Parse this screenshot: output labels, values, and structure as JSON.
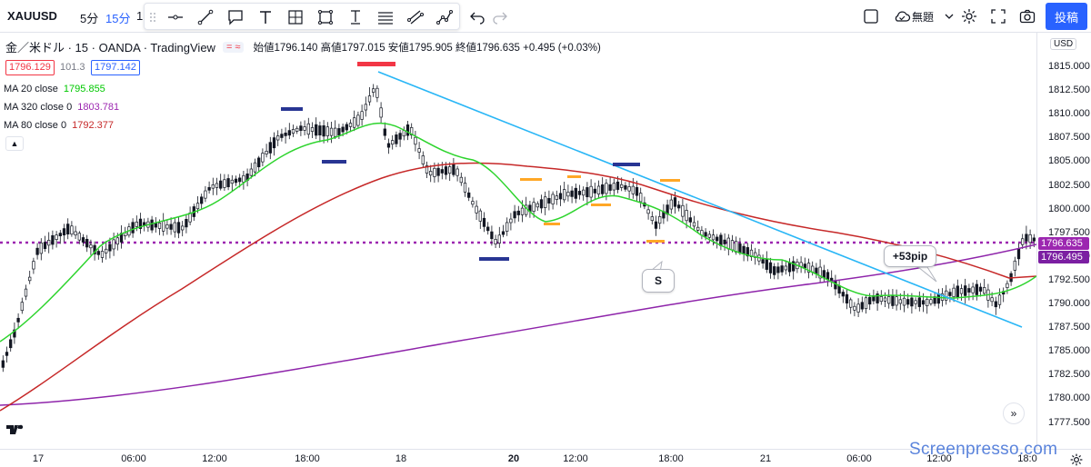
{
  "header": {
    "symbol": "XAUUSD",
    "timeframes": [
      "5分",
      "15分",
      "1"
    ],
    "active_timeframe_index": 1,
    "layout_name": "無題",
    "publish_label": "投稿"
  },
  "legend": {
    "instrument": "金／米ドル · 15 · OANDA · TradingView",
    "ohlc": "始値1796.140 高値1797.015 安値1795.905 終値1796.635 +0.495 (+0.03%)",
    "toggle": "= ≈",
    "bid": "1796.129",
    "spread": "101.3",
    "ask": "1797.142",
    "indicators": [
      {
        "label": "MA 20 close",
        "value": "1795.855",
        "color": "#00c800"
      },
      {
        "label": "MA 320 close 0",
        "value": "1803.781",
        "color": "#9c27b0"
      },
      {
        "label": "MA 80 close 0",
        "value": "1792.377",
        "color": "#c62828"
      }
    ]
  },
  "price_axis": {
    "currency": "USD",
    "ticks": [
      "1815.000",
      "1812.500",
      "1810.000",
      "1807.500",
      "1805.000",
      "1802.500",
      "1800.000",
      "1797.500",
      "1795.000",
      "1792.500",
      "1790.000",
      "1787.500",
      "1785.000",
      "1782.500",
      "1780.000",
      "1777.500"
    ],
    "last_price": "1796.635",
    "line_price": "1796.495",
    "colors": {
      "last": "#9c27b0",
      "line": "#7b1fa2"
    }
  },
  "time_axis": {
    "ticks": [
      {
        "label": "17",
        "bold": false
      },
      {
        "label": "06:00",
        "bold": false
      },
      {
        "label": "12:00",
        "bold": false
      },
      {
        "label": "18:00",
        "bold": false
      },
      {
        "label": "18",
        "bold": false
      },
      {
        "label": "20",
        "bold": true
      },
      {
        "label": "12:00",
        "bold": false
      },
      {
        "label": "18:00",
        "bold": false
      },
      {
        "label": "21",
        "bold": false
      },
      {
        "label": "06:00",
        "bold": false
      },
      {
        "label": "12:00",
        "bold": false
      },
      {
        "label": "18:0",
        "bold": false
      }
    ]
  },
  "annotations": {
    "sell_label": "S",
    "pip_label": "+53pip"
  },
  "watermark": "Screenpresso.com",
  "icons": {
    "tools": [
      "crosshair-icon",
      "horizontal-line-icon",
      "trend-line-icon",
      "callout-icon",
      "text-icon",
      "fib-icon",
      "rectangle-icon",
      "anchored-text-icon",
      "parallel-channel-icon",
      "regression-icon",
      "path-icon"
    ],
    "undo": "undo-icon",
    "redo": "redo-icon"
  }
}
